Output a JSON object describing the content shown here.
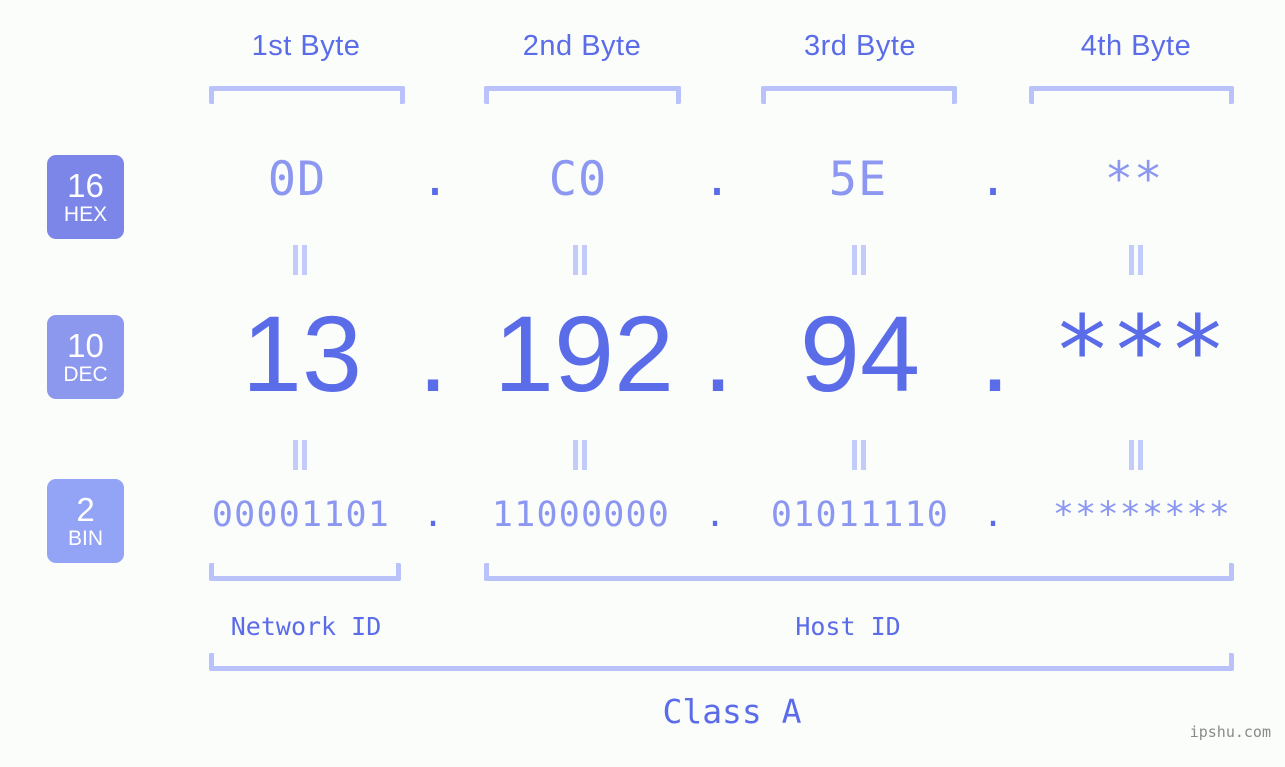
{
  "meta": {
    "background_color": "#fbfdfa",
    "accent_color": "#5b6ce8",
    "light_accent_color": "#b9c2fa",
    "muted_value_color": "#8b97f0"
  },
  "byte_headers": [
    {
      "label": "1st Byte"
    },
    {
      "label": "2nd Byte"
    },
    {
      "label": "3rd Byte"
    },
    {
      "label": "4th Byte"
    }
  ],
  "radix_badges": [
    {
      "number": "16",
      "tag": "HEX",
      "color": "#7b86e8"
    },
    {
      "number": "10",
      "tag": "DEC",
      "color": "#8c97ee"
    },
    {
      "number": "2",
      "tag": "BIN",
      "color": "#93a3f5"
    }
  ],
  "rows": {
    "hex": {
      "values": [
        "0D",
        "C0",
        "5E",
        "**"
      ],
      "separator": "."
    },
    "dec": {
      "values": [
        "13",
        "192",
        "94",
        "***"
      ],
      "separator": "."
    },
    "bin": {
      "values": [
        "00001101",
        "11000000",
        "01011110",
        "********"
      ],
      "separator": "."
    }
  },
  "equals_marker": "||",
  "id_labels": {
    "network": "Network ID",
    "host": "Host ID"
  },
  "class_label": "Class A",
  "watermark": "ipshu.com"
}
